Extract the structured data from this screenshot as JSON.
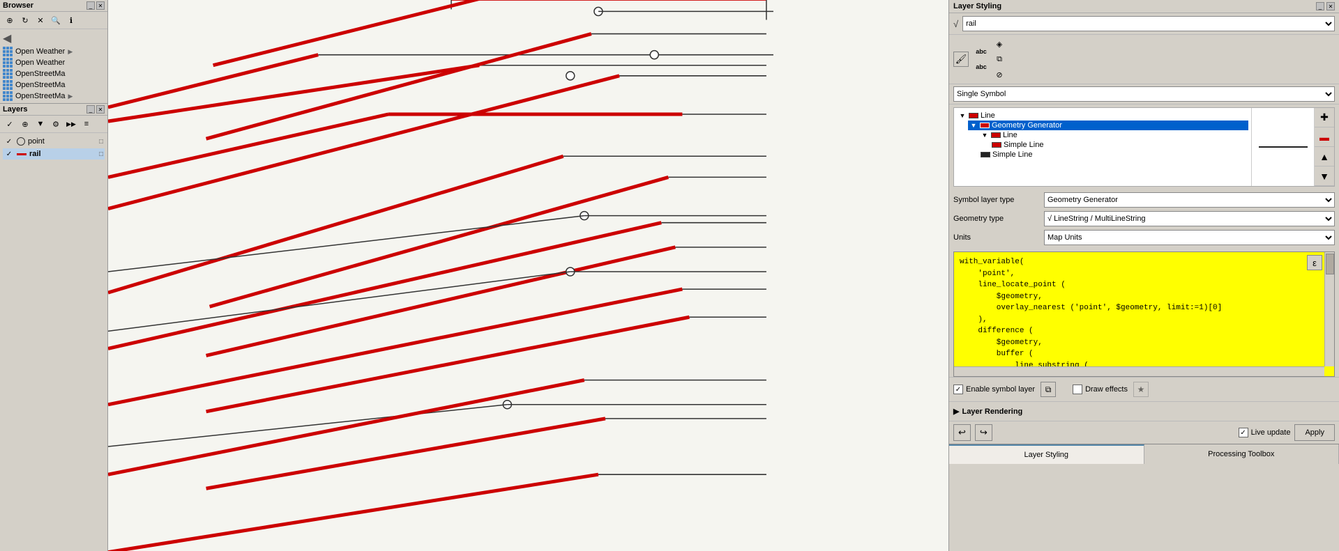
{
  "browser": {
    "title": "Browser",
    "items": [
      {
        "name": "Open Weather",
        "truncated": "Open Weather"
      },
      {
        "name": "Open Weather",
        "truncated": "Open Weather"
      },
      {
        "name": "OpenStreetMa",
        "truncated": "OpenStreetMa"
      },
      {
        "name": "OpenStreetMa",
        "truncated": "OpenStreetMa"
      },
      {
        "name": "OpenStreetMa",
        "truncated": "OpenStreetMa"
      }
    ]
  },
  "layers": {
    "title": "Layers",
    "items": [
      {
        "name": "point",
        "type": "point",
        "checked": true
      },
      {
        "name": "rail",
        "type": "line",
        "checked": true,
        "selected": true
      }
    ]
  },
  "layer_styling": {
    "title": "Layer Styling",
    "layer_name": "rail",
    "symbol_type": "Single Symbol",
    "symbol_layer_type_label": "Symbol layer type",
    "symbol_layer_type_value": "Geometry Generator",
    "geometry_type_label": "Geometry type",
    "geometry_type_value": "LineString / MultiLineString",
    "units_label": "Units",
    "units_value": "Map Units",
    "tree_nodes": [
      {
        "label": "Line",
        "level": 0,
        "color": "red",
        "expanded": true,
        "selected": false
      },
      {
        "label": "Geometry Generator",
        "level": 1,
        "color": "red",
        "expanded": true,
        "selected": true
      },
      {
        "label": "Line",
        "level": 2,
        "color": "red",
        "expanded": true,
        "selected": false
      },
      {
        "label": "Simple Line",
        "level": 3,
        "color": "red",
        "expanded": false,
        "selected": false
      },
      {
        "label": "Simple Line",
        "level": 2,
        "color": "black",
        "expanded": false,
        "selected": false
      }
    ],
    "expression_code": "with_variable(\n    'point',\n    line_locate_point (\n        $geometry,\n        overlay_nearest ('point', $geometry, limit:=1)[0]\n    ),\n    difference (\n        $geometry,\n        buffer (\n            line_substring (\n                $geometry",
    "enable_symbol_layer_label": "Enable symbol layer",
    "draw_effects_label": "Draw effects",
    "layer_rendering_label": "Layer Rendering",
    "live_update_label": "Live update",
    "apply_label": "Apply",
    "tab_layer_styling": "Layer Styling",
    "tab_processing_toolbox": "Processing Toolbox"
  }
}
